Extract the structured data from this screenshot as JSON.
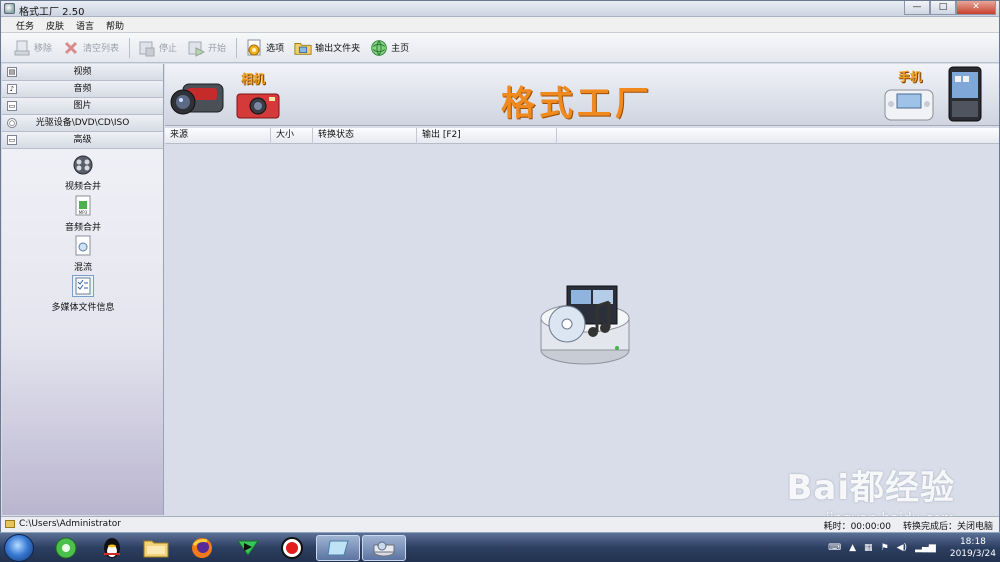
{
  "window": {
    "title": "格式工厂 2.50",
    "controls": [
      "—",
      "□",
      "✕"
    ]
  },
  "menu": [
    "任务",
    "皮肤",
    "语言",
    "帮助"
  ],
  "toolbar": {
    "remove": "移除",
    "clear_list": "清空列表",
    "stop": "停止",
    "start": "开始",
    "options": "选项",
    "output_folder": "输出文件夹",
    "home": "主页"
  },
  "sidebar": {
    "categories": [
      "视频",
      "音频",
      "图片",
      "光驱设备\\DVD\\CD\\ISO",
      "高级"
    ],
    "tools": [
      "视频合并",
      "音频合并",
      "混流",
      "多媒体文件信息"
    ]
  },
  "banner": {
    "title": "格式工厂",
    "camera_label": "相机",
    "phone_label": "手机"
  },
  "table": {
    "columns": [
      "来源",
      "大小",
      "转换状态",
      "输出 [F2]"
    ]
  },
  "status": {
    "path": "C:\\Users\\Administrator",
    "elapsed": "耗时：00:00:00",
    "after_convert": "转换完成后：关闭电脑"
  },
  "watermark": {
    "main": "Bai都经验",
    "sub": "jingyan.baidu.com"
  },
  "taskbar": {
    "time": "18:18",
    "date": "2019/3/24"
  },
  "colors": {
    "banner_title": "#f08a1e",
    "taskbar": "#2d3f62",
    "close_button": "#c7402c"
  }
}
